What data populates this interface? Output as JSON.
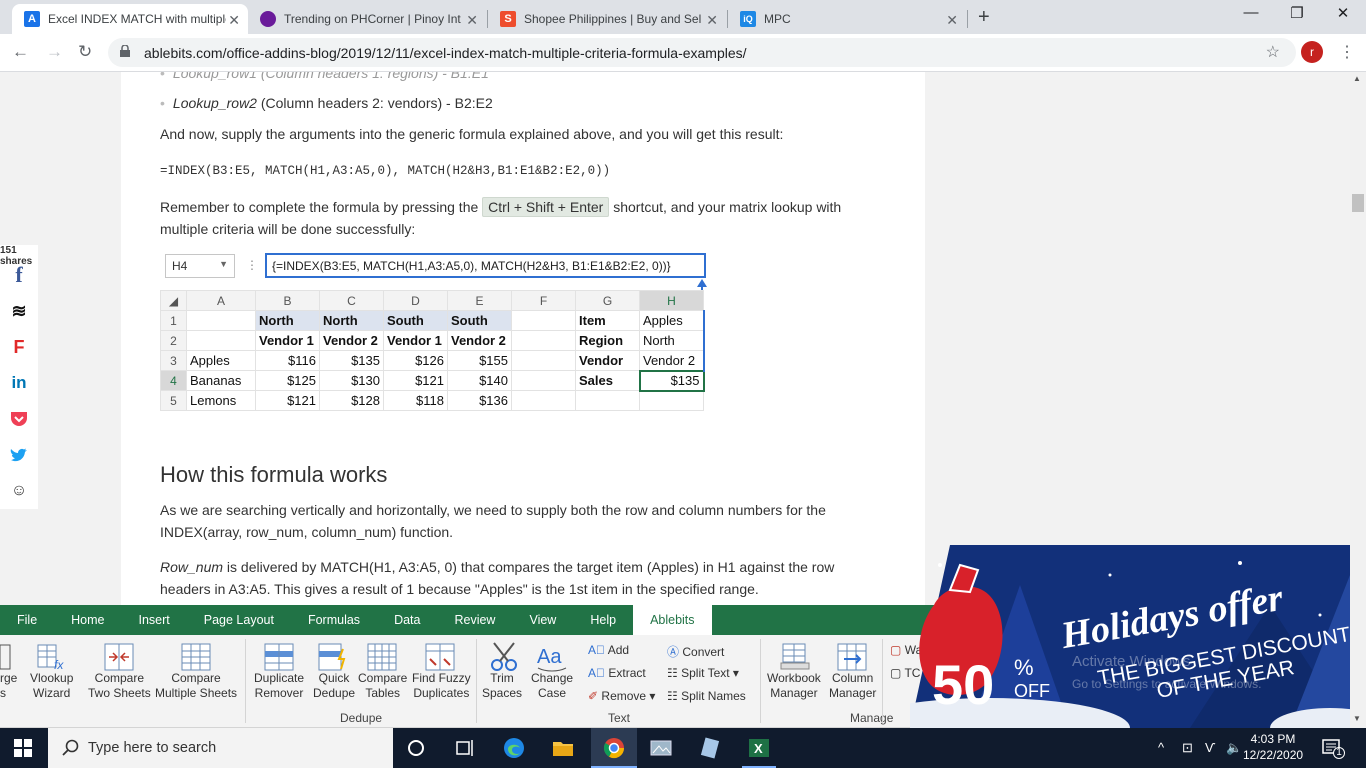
{
  "browser": {
    "tabs": [
      {
        "title": "Excel INDEX MATCH with multiple",
        "fav": "A",
        "color": "#1a73e8",
        "active": true
      },
      {
        "title": "Trending on PHCorner | Pinoy Int",
        "fav": "",
        "color": "#6a1b9a",
        "active": false
      },
      {
        "title": "Shopee Philippines | Buy and Sel",
        "fav": "S",
        "color": "#ee4d2d",
        "active": false
      },
      {
        "title": "MPC",
        "fav": "iQ",
        "color": "#1e88e5",
        "active": false
      }
    ],
    "url": "ablebits.com/office-addins-blog/2019/12/11/excel-index-match-multiple-criteria-formula-examples/",
    "profile_initial": "r"
  },
  "article": {
    "bullet1": "Lookup_row1 (Column headers 1: regions) - B1:E1",
    "bullet2_em": "Lookup_row2",
    "bullet2_rest": " (Column headers 2: vendors) - B2:E2",
    "para1": "And now, supply the arguments into the generic formula explained above, and you will get this result:",
    "formula": "=INDEX(B3:E5, MATCH(H1,A3:A5,0), MATCH(H2&H3,B1:E1&B2:E2,0))",
    "para2_a": "Remember to complete the formula by pressing the ",
    "para2_kbd": "Ctrl + Shift + Enter",
    "para2_b": " shortcut, and your matrix lookup with",
    "para2_c": "multiple criteria will be done successfully:",
    "heading": "How this formula works",
    "para3a": "As we are searching vertically and horizontally, we need to supply both the row and column numbers for the",
    "para3b": "INDEX(array, row_num, column_num) function.",
    "para4_em": "Row_num",
    "para4a": " is delivered by MATCH(H1, A3:A5, 0) that compares the target item (Apples) in H1 against the row",
    "para4b": "headers in A3:A5. This gives a result of 1 because \"Apples\" is the 1st item in the specified range.",
    "shares": "151 shares"
  },
  "excel_shot": {
    "namebox": "H4",
    "formula_bar": "{=INDEX(B3:E5, MATCH(H1,A3:A5,0), MATCH(H2&H3, B1:E1&B2:E2, 0))}",
    "col_headers": [
      "",
      "A",
      "B",
      "C",
      "D",
      "E",
      "F",
      "G",
      "H"
    ],
    "rows": [
      [
        "1",
        "",
        "North",
        "North",
        "South",
        "South",
        "",
        "Item",
        "Apples"
      ],
      [
        "2",
        "",
        "Vendor 1",
        "Vendor 2",
        "Vendor 1",
        "Vendor 2",
        "",
        "Region",
        "North"
      ],
      [
        "3",
        "Apples",
        "$116",
        "$135",
        "$126",
        "$155",
        "",
        "Vendor",
        "Vendor 2"
      ],
      [
        "4",
        "Bananas",
        "$125",
        "$130",
        "$121",
        "$140",
        "",
        "Sales",
        "$135"
      ],
      [
        "5",
        "Lemons",
        "$121",
        "$128",
        "$118",
        "$136",
        "",
        "",
        ""
      ]
    ]
  },
  "ribbon": {
    "tabs": [
      "File",
      "Home",
      "Insert",
      "Page Layout",
      "Formulas",
      "Data",
      "Review",
      "View",
      "Help",
      "Ablebits"
    ],
    "active_tab": "Ablebits",
    "buttons": {
      "merge": "rge\ns",
      "vlookup": "Vlookup\nWizard",
      "compare_two": "Compare\nTwo Sheets",
      "compare_multi": "Compare\nMultiple Sheets",
      "dup_remover": "Duplicate\nRemover",
      "quick_dedupe": "Quick\nDedupe",
      "compare_tables": "Compare\nTables",
      "find_fuzzy": "Find Fuzzy\nDuplicates",
      "trim": "Trim\nSpaces",
      "change_case": "Change\nCase",
      "add": "Add",
      "extract": "Extract",
      "remove": "Remove",
      "convert": "Convert",
      "split_text": "Split Text",
      "split_names": "Split Names",
      "wb_manager": "Workbook\nManager",
      "col_manager": "Column\nManager",
      "wa": "Wa",
      "tc": "TC"
    },
    "groups": {
      "dedupe": "Dedupe",
      "text": "Text",
      "manage": "Manage"
    }
  },
  "promo": {
    "line1": "Holidays offer",
    "line2": "THE BIGGEST DISCOUNT",
    "line3": "OF THE YEAR",
    "pct": "50",
    "pct_sign": "%",
    "off": "OFF",
    "watermark1": "Activate Windows",
    "watermark2": "Go to Settings to activate Windows."
  },
  "taskbar": {
    "search_placeholder": "Type here to search",
    "time": "4:03 PM",
    "date": "12/22/2020",
    "notif_count": "1"
  }
}
